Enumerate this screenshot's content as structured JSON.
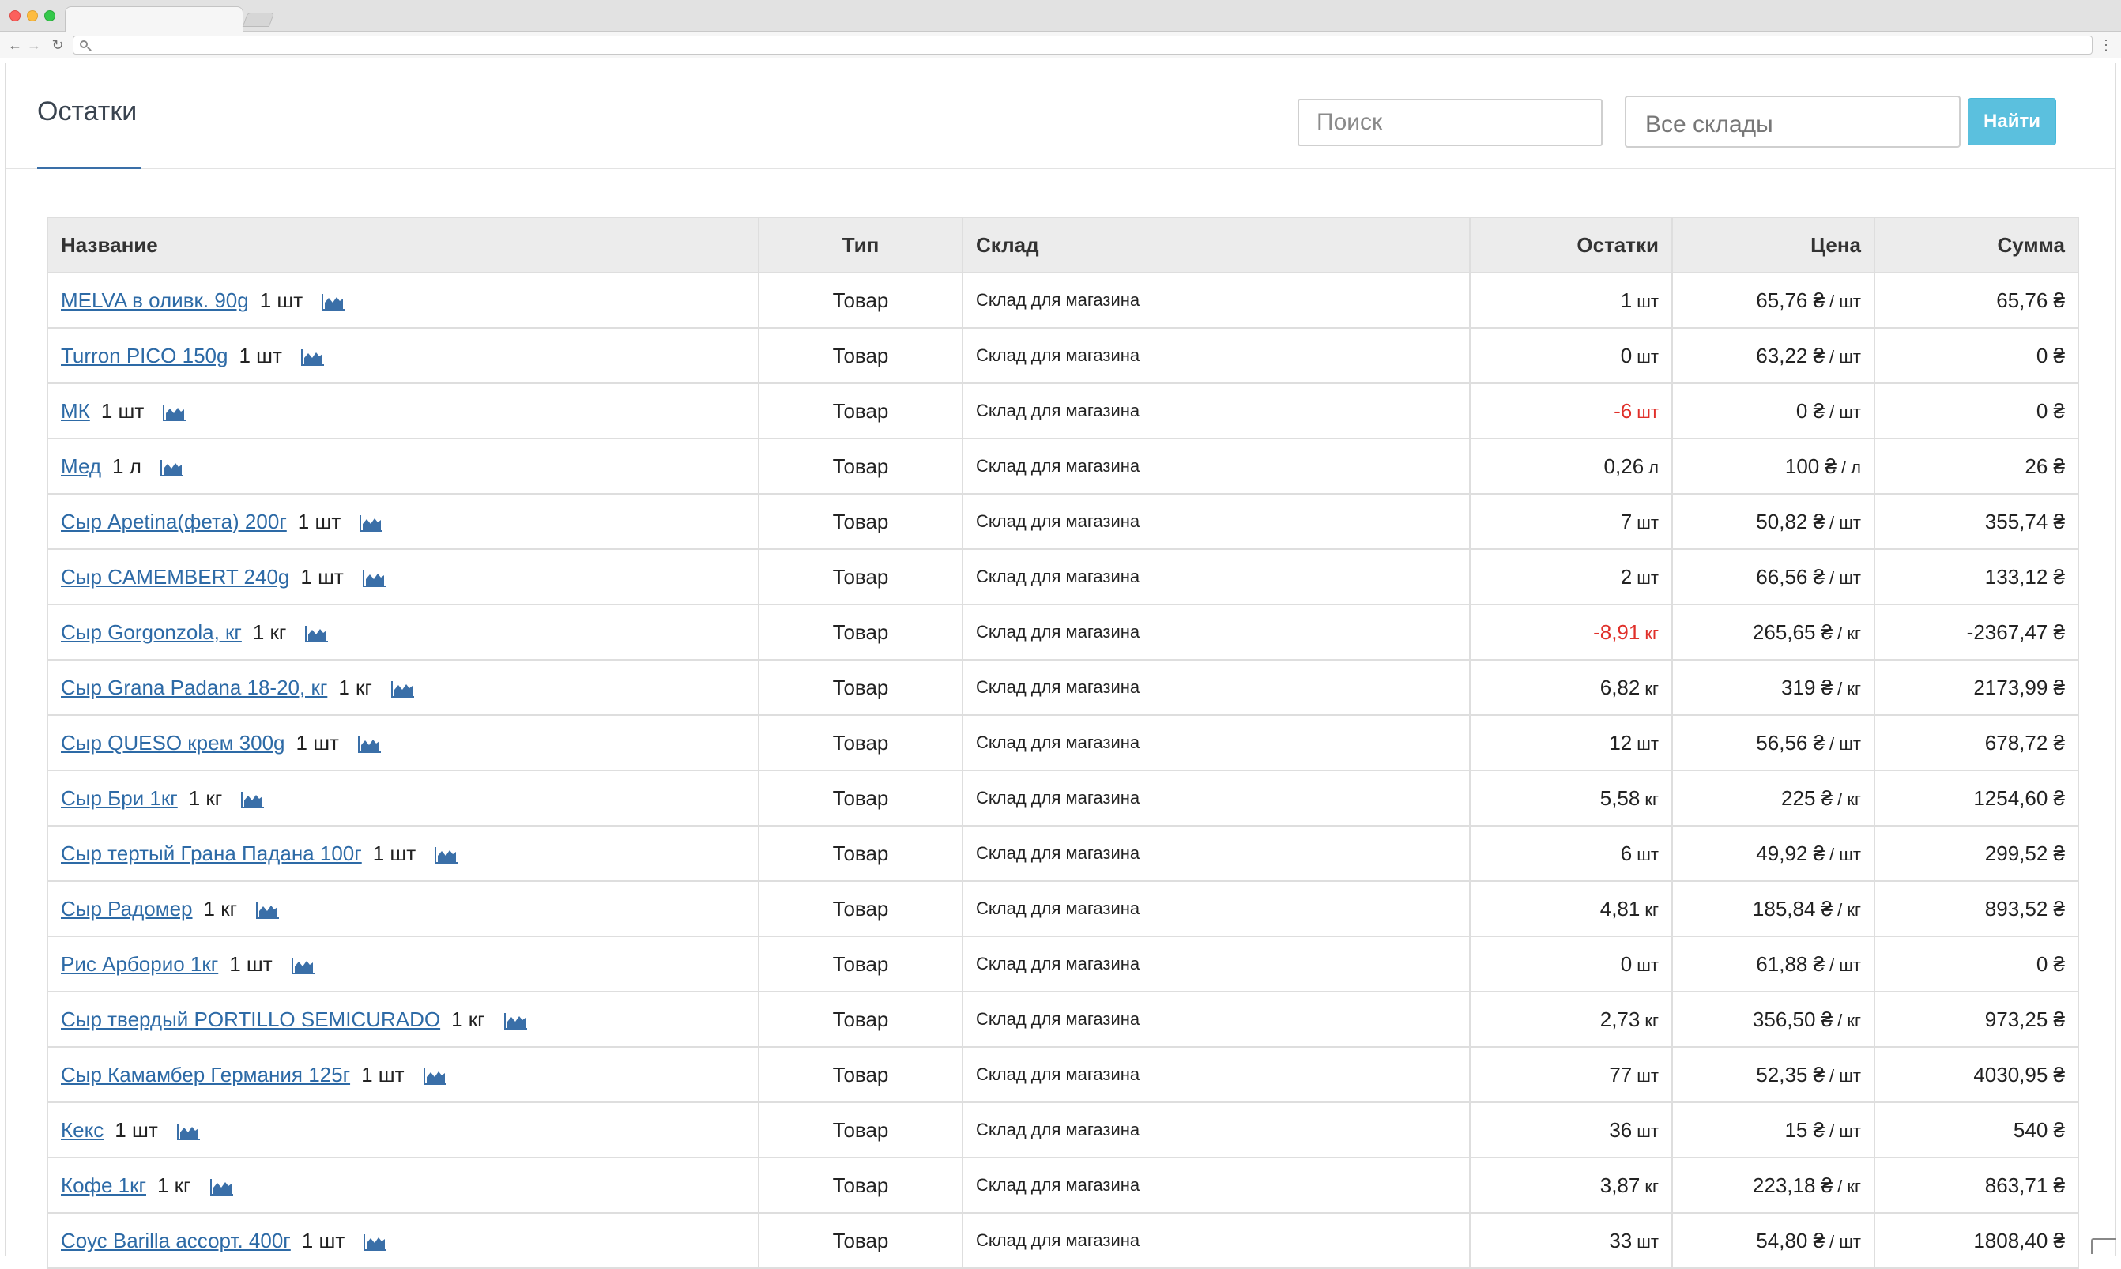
{
  "page": {
    "title": "Остатки",
    "search_placeholder": "Поиск",
    "warehouse_select": "Все склады",
    "find_button": "Найти"
  },
  "table": {
    "headers": {
      "name": "Название",
      "type": "Тип",
      "warehouse": "Склад",
      "stock": "Остатки",
      "price": "Цена",
      "sum": "Сумма"
    },
    "rows": [
      {
        "name": "MELVA в оливк. 90g",
        "unit": "1 шт",
        "type": "Товар",
        "warehouse": "Склад для магазина",
        "stock_value": "1",
        "stock_unit": "шт",
        "stock_negative": false,
        "price_value": "65,76 ₴",
        "price_unit": "/ шт",
        "sum": "65,76 ₴"
      },
      {
        "name": "Turron PICO 150g",
        "unit": "1 шт",
        "type": "Товар",
        "warehouse": "Склад для магазина",
        "stock_value": "0",
        "stock_unit": "шт",
        "stock_negative": false,
        "price_value": "63,22 ₴",
        "price_unit": "/ шт",
        "sum": "0 ₴"
      },
      {
        "name": "МК",
        "unit": "1 шт",
        "type": "Товар",
        "warehouse": "Склад для магазина",
        "stock_value": "-6",
        "stock_unit": "шт",
        "stock_negative": true,
        "price_value": "0 ₴",
        "price_unit": "/ шт",
        "sum": "0 ₴"
      },
      {
        "name": "Мед",
        "unit": "1 л",
        "type": "Товар",
        "warehouse": "Склад для магазина",
        "stock_value": "0,26",
        "stock_unit": "л",
        "stock_negative": false,
        "price_value": "100 ₴",
        "price_unit": "/ л",
        "sum": "26 ₴"
      },
      {
        "name": "Сыр Apetina(фета) 200г",
        "unit": "1 шт",
        "type": "Товар",
        "warehouse": "Склад для магазина",
        "stock_value": "7",
        "stock_unit": "шт",
        "stock_negative": false,
        "price_value": "50,82 ₴",
        "price_unit": "/ шт",
        "sum": "355,74 ₴"
      },
      {
        "name": "Сыр CAMEMBERT 240g",
        "unit": "1 шт",
        "type": "Товар",
        "warehouse": "Склад для магазина",
        "stock_value": "2",
        "stock_unit": "шт",
        "stock_negative": false,
        "price_value": "66,56 ₴",
        "price_unit": "/ шт",
        "sum": "133,12 ₴"
      },
      {
        "name": "Сыр Gorgonzola, кг",
        "unit": "1 кг",
        "type": "Товар",
        "warehouse": "Склад для магазина",
        "stock_value": "-8,91",
        "stock_unit": "кг",
        "stock_negative": true,
        "price_value": "265,65 ₴",
        "price_unit": "/ кг",
        "sum": "-2367,47 ₴"
      },
      {
        "name": "Сыр Grana Padana 18-20, кг",
        "unit": "1 кг",
        "type": "Товар",
        "warehouse": "Склад для магазина",
        "stock_value": "6,82",
        "stock_unit": "кг",
        "stock_negative": false,
        "price_value": "319 ₴",
        "price_unit": "/ кг",
        "sum": "2173,99 ₴"
      },
      {
        "name": "Сыр QUESO крем 300g",
        "unit": "1 шт",
        "type": "Товар",
        "warehouse": "Склад для магазина",
        "stock_value": "12",
        "stock_unit": "шт",
        "stock_negative": false,
        "price_value": "56,56 ₴",
        "price_unit": "/ шт",
        "sum": "678,72 ₴"
      },
      {
        "name": "Сыр Бри 1кг",
        "unit": "1 кг",
        "type": "Товар",
        "warehouse": "Склад для магазина",
        "stock_value": "5,58",
        "stock_unit": "кг",
        "stock_negative": false,
        "price_value": "225 ₴",
        "price_unit": "/ кг",
        "sum": "1254,60 ₴"
      },
      {
        "name": "Сыр тертый Грана Падана 100г",
        "unit": "1 шт",
        "type": "Товар",
        "warehouse": "Склад для магазина",
        "stock_value": "6",
        "stock_unit": "шт",
        "stock_negative": false,
        "price_value": "49,92 ₴",
        "price_unit": "/ шт",
        "sum": "299,52 ₴"
      },
      {
        "name": "Сыр Радомер",
        "unit": "1 кг",
        "type": "Товар",
        "warehouse": "Склад для магазина",
        "stock_value": "4,81",
        "stock_unit": "кг",
        "stock_negative": false,
        "price_value": "185,84 ₴",
        "price_unit": "/ кг",
        "sum": "893,52 ₴"
      },
      {
        "name": "Рис Арборио 1кг",
        "unit": "1 шт",
        "type": "Товар",
        "warehouse": "Склад для магазина",
        "stock_value": "0",
        "stock_unit": "шт",
        "stock_negative": false,
        "price_value": "61,88 ₴",
        "price_unit": "/ шт",
        "sum": "0 ₴"
      },
      {
        "name": "Сыр твердый PORTILLO SEMICURADO",
        "unit": "1 кг",
        "type": "Товар",
        "warehouse": "Склад для магазина",
        "stock_value": "2,73",
        "stock_unit": "кг",
        "stock_negative": false,
        "price_value": "356,50 ₴",
        "price_unit": "/ кг",
        "sum": "973,25 ₴"
      },
      {
        "name": "Сыр Камамбер Германия 125г",
        "unit": "1 шт",
        "type": "Товар",
        "warehouse": "Склад для магазина",
        "stock_value": "77",
        "stock_unit": "шт",
        "stock_negative": false,
        "price_value": "52,35 ₴",
        "price_unit": "/ шт",
        "sum": "4030,95 ₴"
      },
      {
        "name": "Кекс",
        "unit": "1 шт",
        "type": "Товар",
        "warehouse": "Склад для магазина",
        "stock_value": "36",
        "stock_unit": "шт",
        "stock_negative": false,
        "price_value": "15 ₴",
        "price_unit": "/ шт",
        "sum": "540 ₴"
      },
      {
        "name": "Кофе 1кг",
        "unit": "1 кг",
        "type": "Товар",
        "warehouse": "Склад для магазина",
        "stock_value": "3,87",
        "stock_unit": "кг",
        "stock_negative": false,
        "price_value": "223,18 ₴",
        "price_unit": "/ кг",
        "sum": "863,71 ₴"
      },
      {
        "name": "Соус Barilla ассорт. 400г",
        "unit": "1 шт",
        "type": "Товар",
        "warehouse": "Склад для магазина",
        "stock_value": "33",
        "stock_unit": "шт",
        "stock_negative": false,
        "price_value": "54,80 ₴",
        "price_unit": "/ шт",
        "sum": "1808,40 ₴"
      }
    ]
  },
  "icons": {
    "row_stats_icon": "area-chart-icon"
  },
  "colors": {
    "link": "#2d6aa6",
    "negative": "#e0302a",
    "find_button": "#5bc0de",
    "icon": "#3a6fa8"
  }
}
